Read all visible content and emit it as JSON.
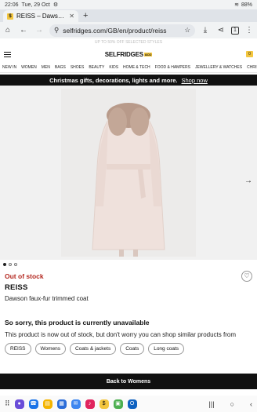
{
  "status_bar": {
    "time": "22:06",
    "date": "Tue, 29 Oct",
    "battery": "88%"
  },
  "browser": {
    "tab_title": "REISS – Dawson fau",
    "url": "selfridges.com/GB/en/product/reiss",
    "tab_count": "1"
  },
  "site": {
    "promo_faint": "UP TO 50% OFF SELECTED STYLES",
    "logo": "SELFRIDGES",
    "logo_tag": "&CO",
    "categories": [
      "NEW IN",
      "WOMEN",
      "MEN",
      "BAGS",
      "SHOES",
      "BEAUTY",
      "KIDS",
      "HOME & TECH",
      "FOOD & HAMPERS",
      "JEWELLERY & WATCHES",
      "CHRISTMAS"
    ],
    "banner_text": "Christmas gifts, decorations, lights and more.",
    "banner_link": "Shop now"
  },
  "product": {
    "status": "Out of stock",
    "brand": "REISS",
    "name": "Dawson faux-fur trimmed coat",
    "image_count": 3,
    "current_image": 1
  },
  "unavailable": {
    "heading": "So sorry, this product is currently unavailable",
    "message": "This product is now out of stock, but don't worry you can shop similar products from"
  },
  "chips": [
    "REISS",
    "Womens",
    "Coats & jackets",
    "Coats",
    "Long coats"
  ],
  "back_button": "Back to Womens",
  "colors": {
    "accent": "#f3c63f",
    "out_of_stock": "#b3261e",
    "coat": "#efe1dc",
    "fur": "#b89a8a"
  }
}
